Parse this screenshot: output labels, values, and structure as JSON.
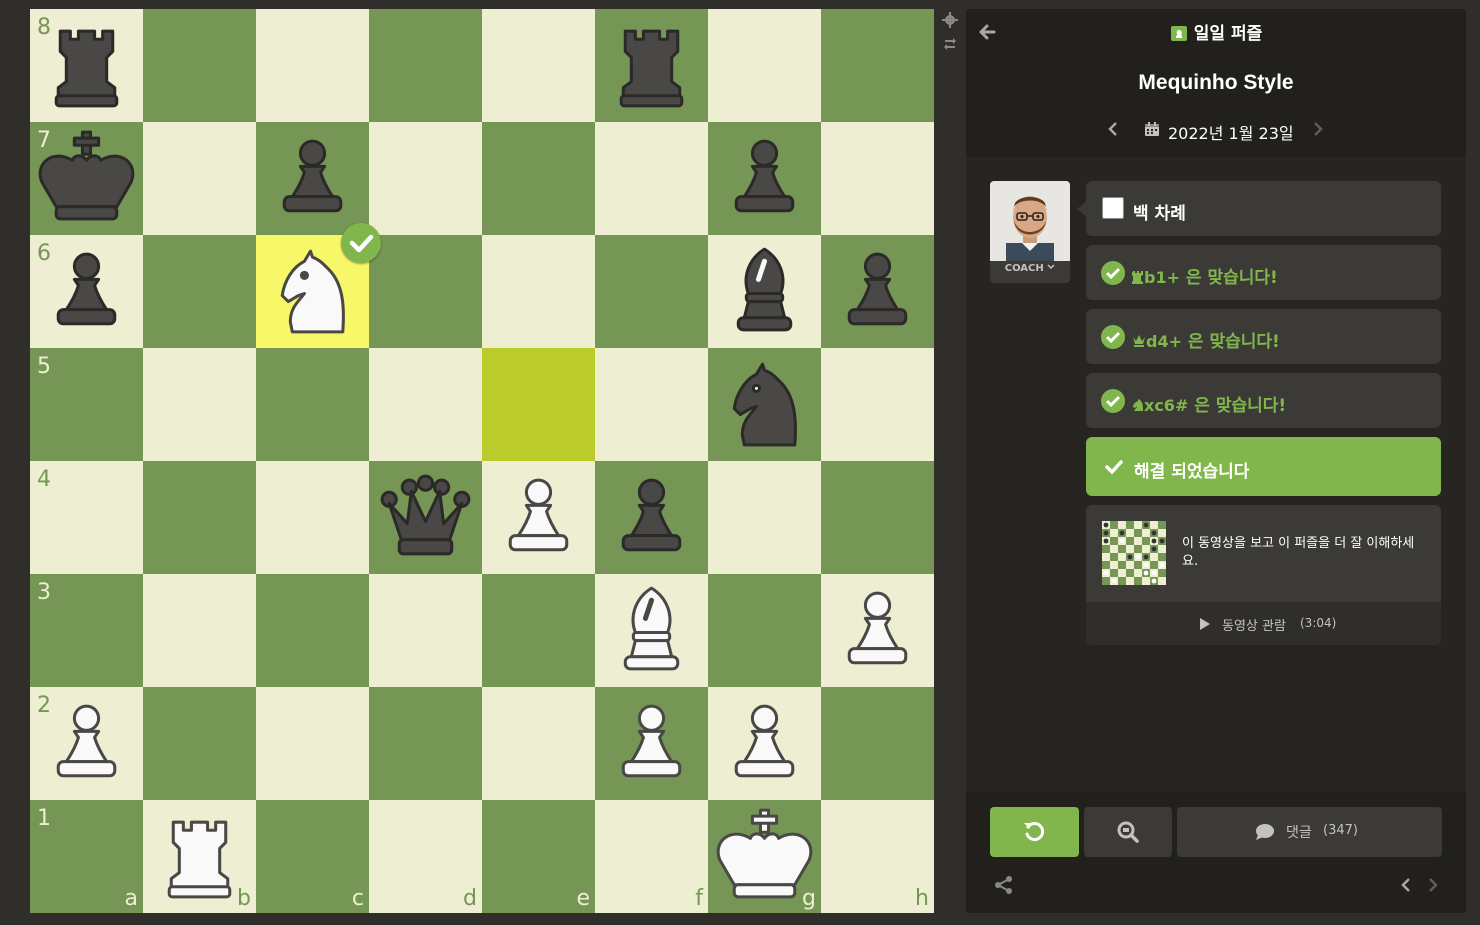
{
  "board": {
    "ranks": [
      "8",
      "7",
      "6",
      "5",
      "4",
      "3",
      "2",
      "1"
    ],
    "files": [
      "a",
      "b",
      "c",
      "d",
      "e",
      "f",
      "g",
      "h"
    ],
    "highlighted_squares": [
      "c6",
      "e5"
    ],
    "correct_marker_square": "c6",
    "pieces": [
      {
        "square": "a8",
        "piece": "black-rook"
      },
      {
        "square": "f8",
        "piece": "black-rook"
      },
      {
        "square": "a7",
        "piece": "black-king"
      },
      {
        "square": "c7",
        "piece": "black-pawn"
      },
      {
        "square": "g7",
        "piece": "black-pawn"
      },
      {
        "square": "a6",
        "piece": "black-pawn"
      },
      {
        "square": "c6",
        "piece": "white-knight"
      },
      {
        "square": "g6",
        "piece": "black-bishop"
      },
      {
        "square": "h6",
        "piece": "black-pawn"
      },
      {
        "square": "g5",
        "piece": "black-knight"
      },
      {
        "square": "d4",
        "piece": "black-queen"
      },
      {
        "square": "e4",
        "piece": "white-pawn"
      },
      {
        "square": "f4",
        "piece": "black-pawn"
      },
      {
        "square": "f3",
        "piece": "white-bishop"
      },
      {
        "square": "h3",
        "piece": "white-pawn"
      },
      {
        "square": "a2",
        "piece": "white-pawn"
      },
      {
        "square": "f2",
        "piece": "white-pawn"
      },
      {
        "square": "g2",
        "piece": "white-pawn"
      },
      {
        "square": "b1",
        "piece": "white-rook"
      },
      {
        "square": "g1",
        "piece": "white-king"
      }
    ]
  },
  "side_tools": {
    "settings_icon": "gear-icon",
    "flip_icon": "flip-board-icon"
  },
  "panel": {
    "header_title": "일일 퍼즐",
    "puzzle_name": "Mequinho Style",
    "date": "2022년 1월 23일",
    "coach_label": "COACH",
    "messages": [
      {
        "text": "백 차례"
      },
      {
        "move": "b1+",
        "suffix": " 은 맞습니다!"
      },
      {
        "move": "d4+",
        "suffix": " 은 맞습니다!"
      },
      {
        "move": "xc6#",
        "suffix": " 은 맞습니다!"
      }
    ],
    "solved_text": "해결 되었습니다",
    "video_text": "이 동영상을 보고 이 퍼즐을 더 잘 이해하세요.",
    "watch_label": "동영상 관람",
    "watch_duration": "(3:04)",
    "comments_label": "댓글",
    "comments_count": "(347)"
  },
  "colors": {
    "light": "#eeeed2",
    "dark": "#769656",
    "accent": "#81b64c",
    "highlight": "#f7f769",
    "last_move": "#bbcb2b"
  }
}
